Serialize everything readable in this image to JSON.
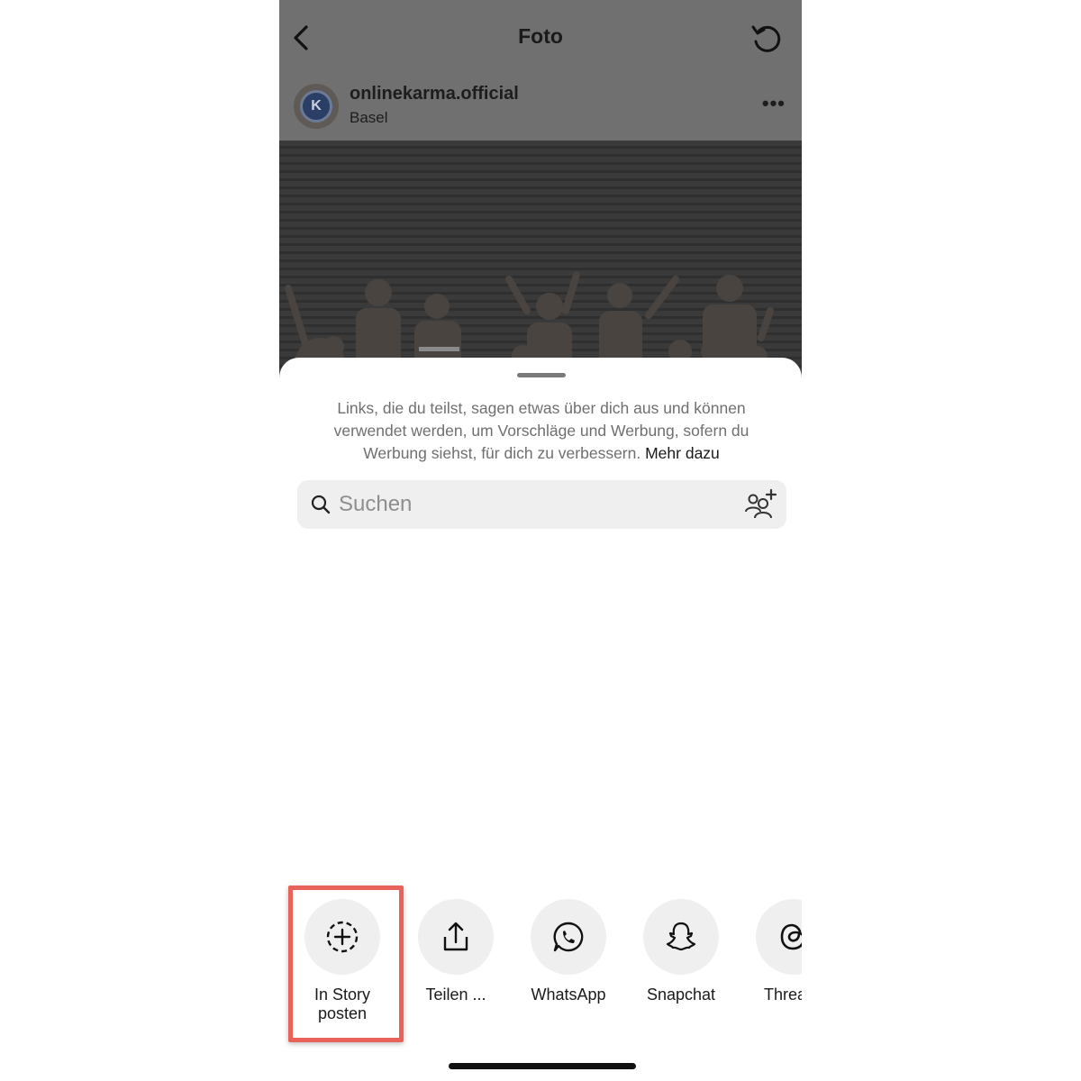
{
  "header": {
    "title": "Foto"
  },
  "post": {
    "username": "onlinekarma.official",
    "location": "Basel",
    "avatar_letter": "K"
  },
  "sheet": {
    "notice_text": "Links, die du teilst, sagen etwas über dich aus und können verwendet werden, um Vorschläge und Werbung, sofern du Werbung siehst, für dich zu verbessern.",
    "notice_link": "Mehr dazu",
    "search_placeholder": "Suchen"
  },
  "share_options": [
    {
      "label": "In Story posten",
      "icon": "add-story-icon"
    },
    {
      "label": "Teilen ...",
      "icon": "share-icon"
    },
    {
      "label": "WhatsApp",
      "icon": "whatsapp-icon"
    },
    {
      "label": "Snapchat",
      "icon": "snapchat-icon"
    },
    {
      "label": "Threads",
      "icon": "threads-icon"
    }
  ],
  "colors": {
    "highlight": "#e8625a",
    "dim_overlay": "#707070",
    "sheet_bg": "#ffffff"
  }
}
